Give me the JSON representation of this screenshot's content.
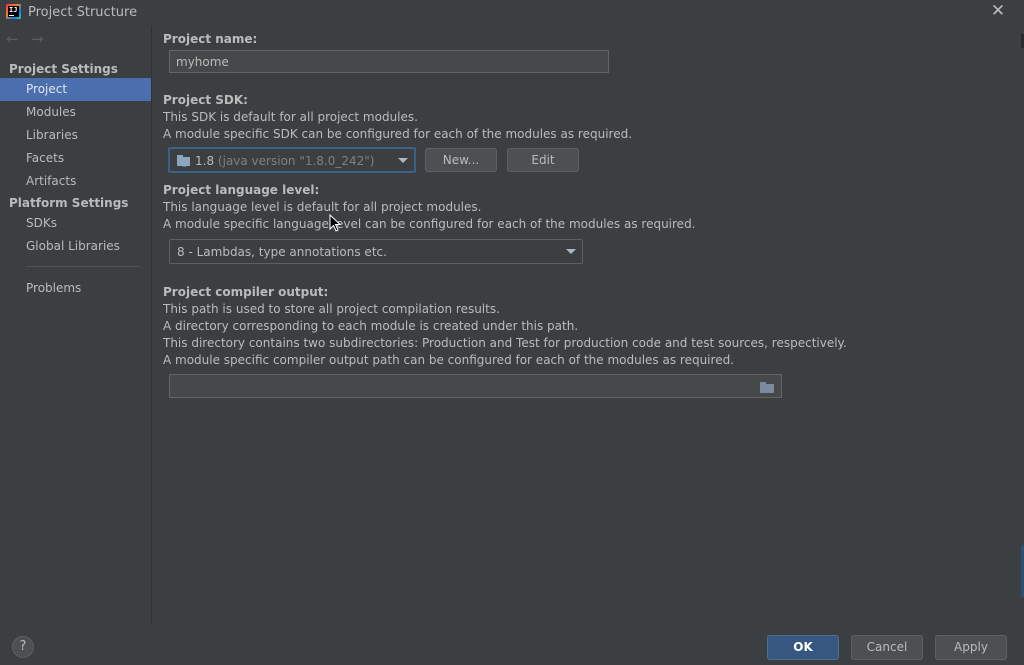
{
  "window": {
    "title": "Project Structure"
  },
  "sidebar": {
    "project_settings_header": "Project Settings",
    "items_project": [
      {
        "label": "Project",
        "selected": true
      },
      {
        "label": "Modules"
      },
      {
        "label": "Libraries"
      },
      {
        "label": "Facets"
      },
      {
        "label": "Artifacts"
      }
    ],
    "platform_settings_header": "Platform Settings",
    "items_platform": [
      {
        "label": "SDKs"
      },
      {
        "label": "Global Libraries"
      }
    ],
    "problems_label": "Problems"
  },
  "main": {
    "project_name": {
      "label": "Project name:",
      "value": "myhome"
    },
    "project_sdk": {
      "label": "Project SDK:",
      "desc1": "This SDK is default for all project modules.",
      "desc2": "A module specific SDK can be configured for each of the modules as required.",
      "version": "1.8",
      "version_detail": "(java version \"1.8.0_242\")",
      "new_button": "New...",
      "edit_button": "Edit"
    },
    "language_level": {
      "label": "Project language level:",
      "desc1": "This language level is default for all project modules.",
      "desc2": "A module specific language level can be configured for each of the modules as required.",
      "value": "8 - Lambdas, type annotations etc."
    },
    "compiler_output": {
      "label": "Project compiler output:",
      "desc1": "This path is used to store all project compilation results.",
      "desc2": "A directory corresponding to each module is created under this path.",
      "desc3": "This directory contains two subdirectories: Production and Test for production code and test sources, respectively.",
      "desc4": "A module specific compiler output path can be configured for each of the modules as required.",
      "value": ""
    }
  },
  "footer": {
    "help": "?",
    "ok": "OK",
    "cancel": "Cancel",
    "apply": "Apply"
  },
  "colors": {
    "background": "#3c3f41",
    "selection": "#4b6eaf",
    "default_button": "#365880",
    "text": "#bbbbbb"
  }
}
